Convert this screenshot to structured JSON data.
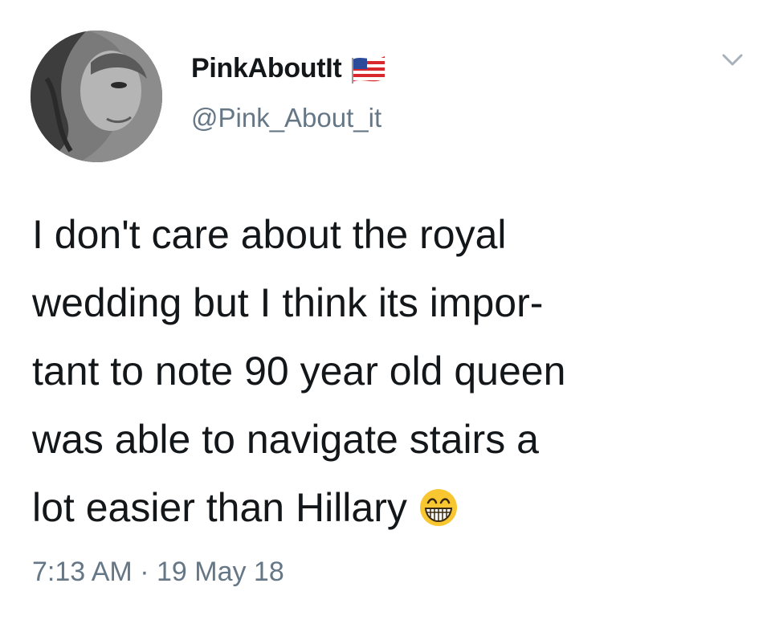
{
  "author": {
    "display_name": "PinkAboutIt",
    "handle": "@Pink_About_it",
    "flag_icon": "us-flag-icon",
    "avatar": "profile-photo"
  },
  "menu_icon": "chevron-down-icon",
  "tweet": {
    "lines": [
      "I don't care about the royal",
      "wedding but I think its impor-",
      "tant to note 90 year old queen",
      "was able to navigate stairs a",
      "lot easier than Hillary"
    ],
    "emoji": "grinning-face-icon"
  },
  "timestamp": {
    "time": "7:13 AM",
    "separator": "·",
    "date": "19 May 18"
  },
  "colors": {
    "text": "#14171a",
    "secondary": "#657786",
    "background": "#ffffff"
  }
}
